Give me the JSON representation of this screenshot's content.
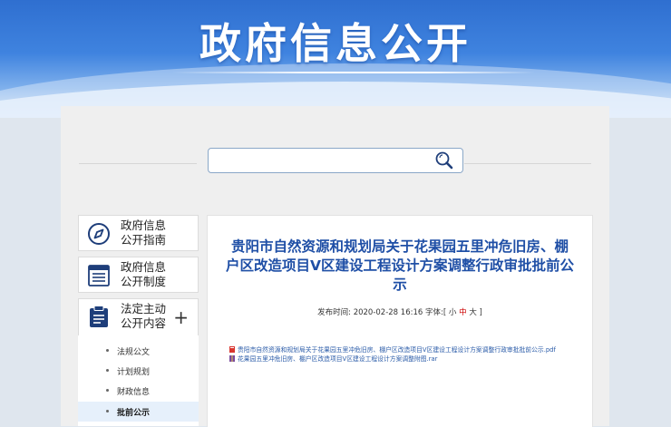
{
  "header": {
    "title": "政府信息公开"
  },
  "search": {
    "placeholder": "",
    "value": ""
  },
  "sidebar": {
    "items": [
      {
        "label_line1": "政府信息",
        "label_line2": "公开指南",
        "icon": "compass-icon"
      },
      {
        "label_line1": "政府信息",
        "label_line2": "公开制度",
        "icon": "list-document-icon"
      },
      {
        "label_line1": "法定主动",
        "label_line2": "公开内容",
        "icon": "clipboard-icon",
        "expand": "+"
      }
    ],
    "subitems": [
      {
        "label": "法规公文"
      },
      {
        "label": "计划规划"
      },
      {
        "label": "财政信息"
      },
      {
        "label": "批前公示",
        "active": true
      }
    ]
  },
  "article": {
    "title": "贵阳市自然资源和规划局关于花果园五里冲危旧房、棚户区改造项目V区建设工程设计方案调整行政审批批前公示",
    "publish_label": "发布时间: ",
    "publish_time": "2020-02-28 16:16",
    "font_label": "字体:[",
    "font_small": "小",
    "font_mid": "中",
    "font_large": "大",
    "font_close": "]",
    "attachments": [
      {
        "name": "贵阳市自然资源和规划局关于花果园五里冲危旧房、棚户区改造项目V区建设工程设计方案调整行政审批批前公示.pdf",
        "type": "pdf"
      },
      {
        "name": "花果园五里冲危旧房、棚户区改造项目V区建设工程设计方案调整附图.rar",
        "type": "rar"
      }
    ]
  },
  "colors": {
    "title_blue": "#1f4fa6",
    "link_blue": "#2a5ba8",
    "accent_red": "#cc0000",
    "banner_blue": "#3f83df"
  }
}
